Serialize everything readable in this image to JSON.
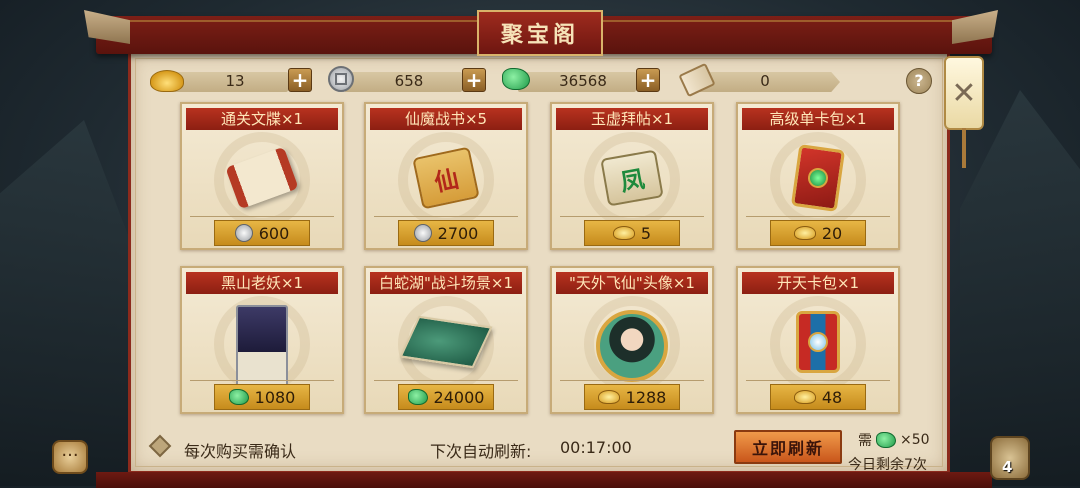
{
  "header": {
    "title": "聚宝阁"
  },
  "resources": [
    {
      "icon": "gold-ingot-icon",
      "value": "13"
    },
    {
      "icon": "silver-coin-icon",
      "value": "658"
    },
    {
      "icon": "jade-icon",
      "value": "36568"
    },
    {
      "icon": "scroll-icon",
      "value": "0"
    }
  ],
  "help_label": "?",
  "close_label": "✕",
  "items": [
    {
      "title": "通关文牒×1",
      "price": "600",
      "currency": "silver"
    },
    {
      "title": "仙魔战书×5",
      "price": "2700",
      "currency": "silver"
    },
    {
      "title": "玉虚拜帖×1",
      "price": "5",
      "currency": "gold"
    },
    {
      "title": "高级单卡包×1",
      "price": "20",
      "currency": "gold"
    },
    {
      "title": "黑山老妖×1",
      "price": "1080",
      "currency": "jade"
    },
    {
      "title": "白蛇湖\"战斗场景×1",
      "price": "24000",
      "currency": "jade"
    },
    {
      "title": "\"天外飞仙\"头像×1",
      "price": "1288",
      "currency": "gold"
    },
    {
      "title": "开天卡包×1",
      "price": "48",
      "currency": "gold"
    }
  ],
  "item_art_text": {
    "scroll_gold": "仙",
    "scroll_green": "凤"
  },
  "footer": {
    "confirm_label": "每次购买需确认",
    "auto_refresh_label": "下次自动刷新:",
    "auto_refresh_time": "00:17:00",
    "refresh_button": "立即刷新",
    "cost_prefix": "需",
    "cost_amount": "×50",
    "remaining": "今日剩余7次"
  },
  "chat_label": "···",
  "right_badge": "4",
  "colors": {
    "accent": "#8c1f12",
    "gold": "#d79a1c",
    "jade": "#1f9a48",
    "panel": "#e9dcc3"
  }
}
